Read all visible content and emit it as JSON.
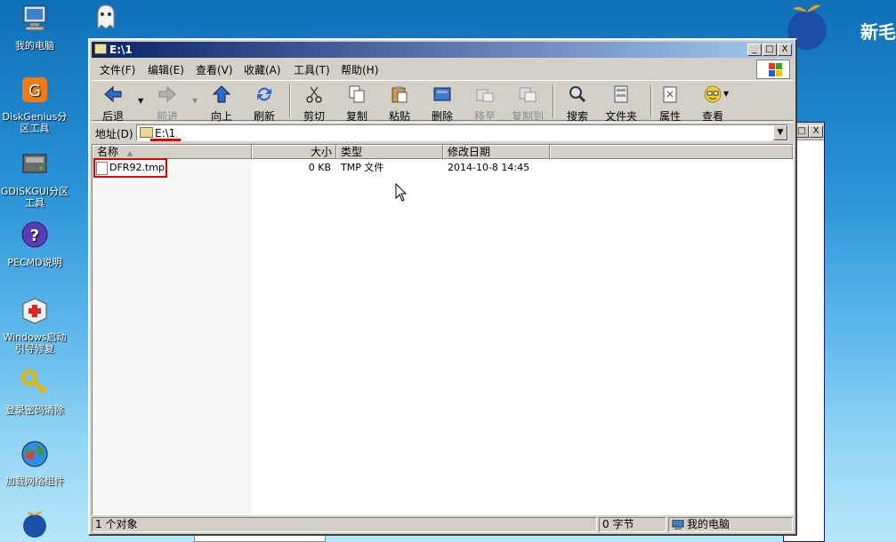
{
  "desktop": {
    "icons": [
      {
        "label": "我的电脑"
      },
      {
        "label": "DiskGenius分区工具"
      },
      {
        "label": "GDISKGUI分区工具"
      },
      {
        "label": "PECMD说明"
      },
      {
        "label": "Windows启动引导修复"
      },
      {
        "label": "登录密码清除"
      },
      {
        "label": "加载网络组件"
      }
    ],
    "brand_text": "新毛"
  },
  "window": {
    "title": "E:\\1",
    "buttons": {
      "minimize": "_",
      "maximize": "□",
      "close": "X"
    },
    "menu": [
      "文件(F)",
      "编辑(E)",
      "查看(V)",
      "收藏(A)",
      "工具(T)",
      "帮助(H)"
    ],
    "toolbar": {
      "back": "后退",
      "forward": "前进",
      "up": "向上",
      "refresh": "刷新",
      "cut": "剪切",
      "copy": "复制",
      "paste": "粘贴",
      "delete": "删除",
      "move_to": "移至",
      "copy_to": "复制到",
      "search": "搜索",
      "folders": "文件夹",
      "properties": "属性",
      "view": "查看"
    },
    "address": {
      "label": "地址(D)",
      "value": "E:\\1"
    },
    "columns": {
      "name": "名称",
      "size": "大小",
      "type": "类型",
      "modified": "修改日期"
    },
    "files": [
      {
        "name": "DFR92.tmp",
        "size": "0 KB",
        "type": "TMP 文件",
        "modified": "2014-10-8 14:45"
      }
    ],
    "status": {
      "objects": "1 个对象",
      "bytes": "0 字节",
      "location": "我的电脑"
    }
  },
  "colors": {
    "title_start": "#0a246a",
    "title_end": "#a6caf0",
    "highlight": "#e00000"
  }
}
